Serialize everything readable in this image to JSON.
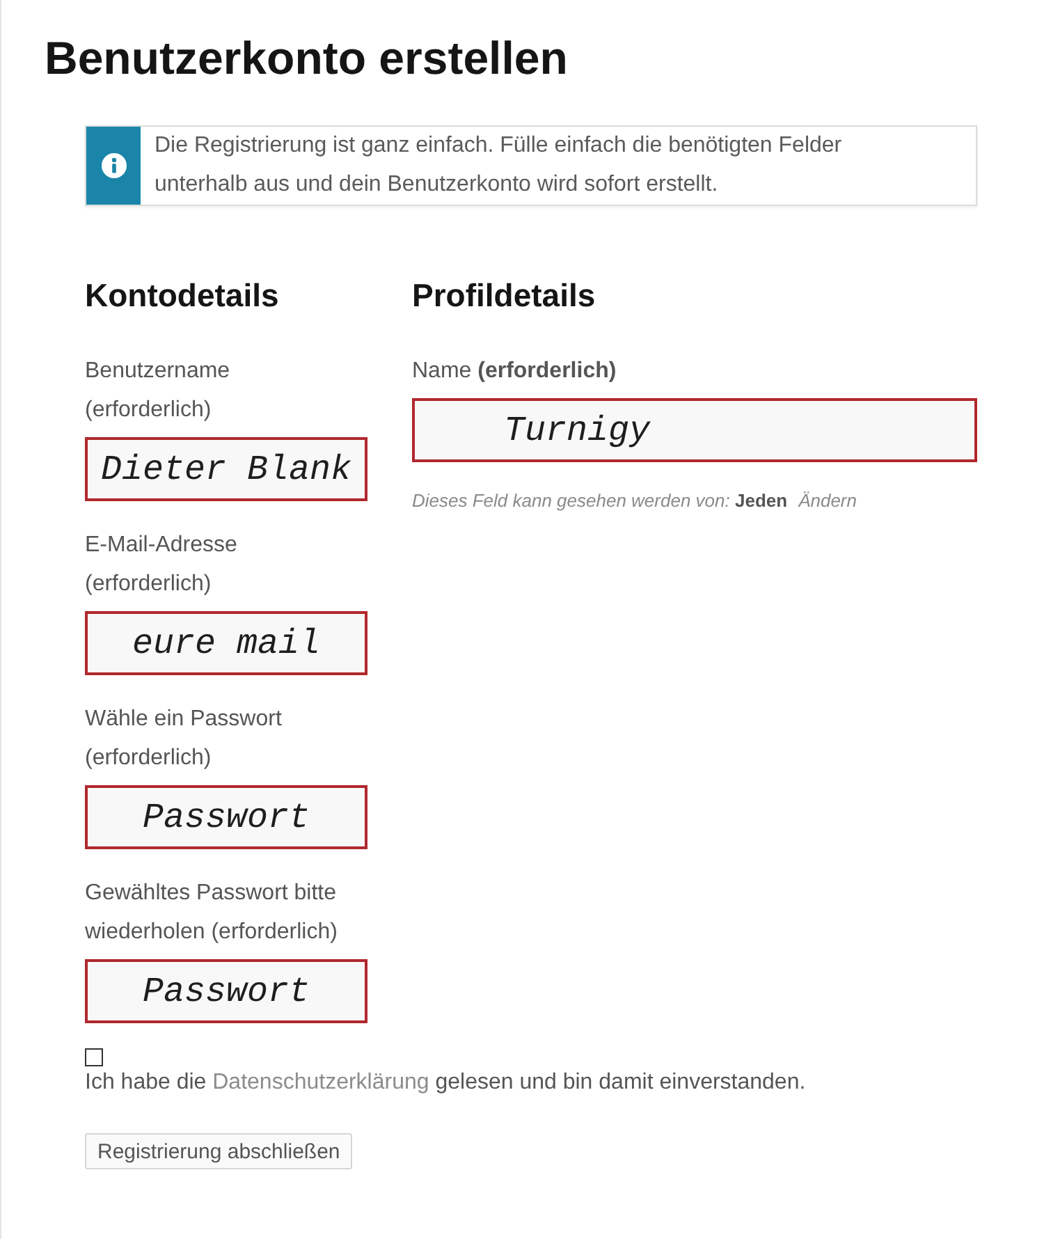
{
  "page": {
    "title": "Benutzerkonto erstellen"
  },
  "notice": {
    "text": "Die Registrierung ist ganz einfach. Fülle einfach die benötigten Felder unterhalb aus und dein Benutzerkonto wird sofort erstellt."
  },
  "account": {
    "heading": "Kontodetails",
    "fields": [
      {
        "label": "Benutzername\n(erforderlich)",
        "value": "Dieter Blank"
      },
      {
        "label": "E-Mail-Adresse\n(erforderlich)",
        "value": "eure mail"
      },
      {
        "label": "Wähle ein Passwort\n(erforderlich)",
        "value": "Passwort"
      },
      {
        "label": "Gewähltes Passwort bitte\nwiederholen (erforderlich)",
        "value": "Passwort"
      }
    ]
  },
  "profile": {
    "heading": "Profildetails",
    "fields": [
      {
        "label": "Name **(erforderlich)**",
        "value": "Turnigy",
        "visibility": {
          "text": "Dieses Feld kann gesehen werden von: **Jeden**",
          "link": "Ändern"
        }
      }
    ]
  },
  "consent": {
    "checked": false,
    "text_before": "Ich habe die",
    "link": "Datenschutzerklärung",
    "text_after": "gelesen und bin damit einverstanden."
  },
  "submit": {
    "label": "Registrierung abschließen"
  }
}
